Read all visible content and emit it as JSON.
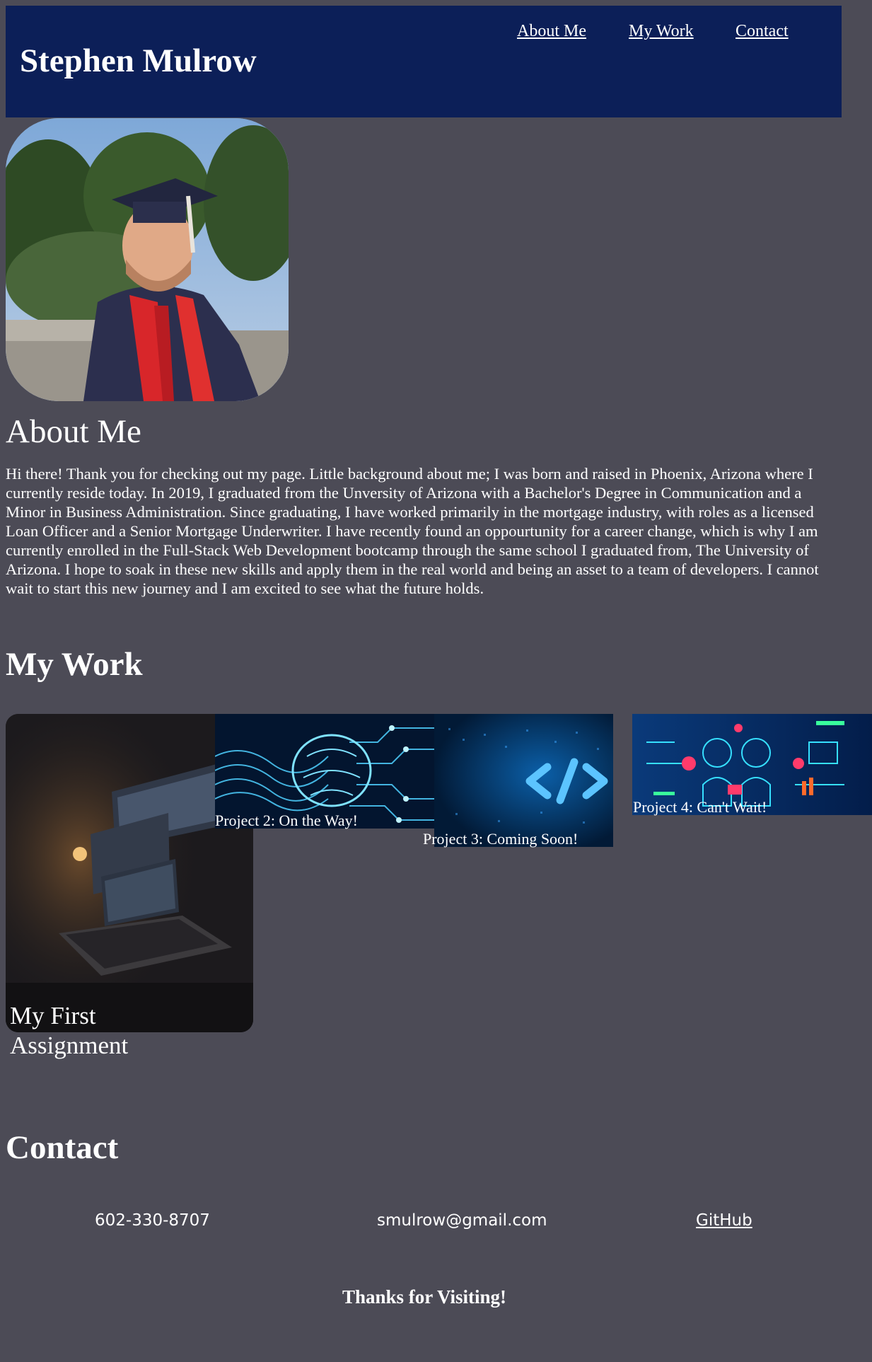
{
  "header": {
    "title": "Stephen Mulrow",
    "nav": [
      {
        "label": "About Me"
      },
      {
        "label": "My Work"
      },
      {
        "label": "Contact"
      }
    ],
    "background": "#0c1f58"
  },
  "about": {
    "heading": "About Me",
    "text": "Hi there! Thank you for checking out my page. Little background about me; I was born and raised in Phoenix, Arizona where I currently reside today. In 2019, I graduated from the Unversity of Arizona with a Bachelor's Degree in Communication and a Minor in Business Administration. Since graduating, I have worked primarily in the mortgage industry, with roles as a licensed Loan Officer and a Senior Mortgage Underwriter. I have recently found an oppourtunity for a career change, which is why I am currently enrolled in the Full-Stack Web Development bootcamp through the same school I graduated from, The University of Arizona. I hope to soak in these new skills and apply them in the real world and being an asset to a team of developers. I cannot wait to start this new journey and I am excited to see what the future holds."
  },
  "work": {
    "heading": "My Work",
    "projects": [
      {
        "label": "My First Assignment",
        "image": "laptop-photo"
      },
      {
        "label": "Project 2: On the Way!",
        "image": "circuit-brain-image"
      },
      {
        "label": "Project 3: Coming Soon!",
        "image": "coding-image"
      },
      {
        "label": "Project 4: Can't Wait!",
        "image": "tech-kids-illustration"
      }
    ]
  },
  "contact": {
    "heading": "Contact",
    "phone": "602-330-8707",
    "email": "smulrow@gmail.com",
    "github": "GitHub"
  },
  "footer": {
    "text": "Thanks for Visiting!"
  },
  "colors": {
    "page_background": "#4c4b56",
    "header_background": "#0c1f58",
    "text": "#ffffff"
  }
}
